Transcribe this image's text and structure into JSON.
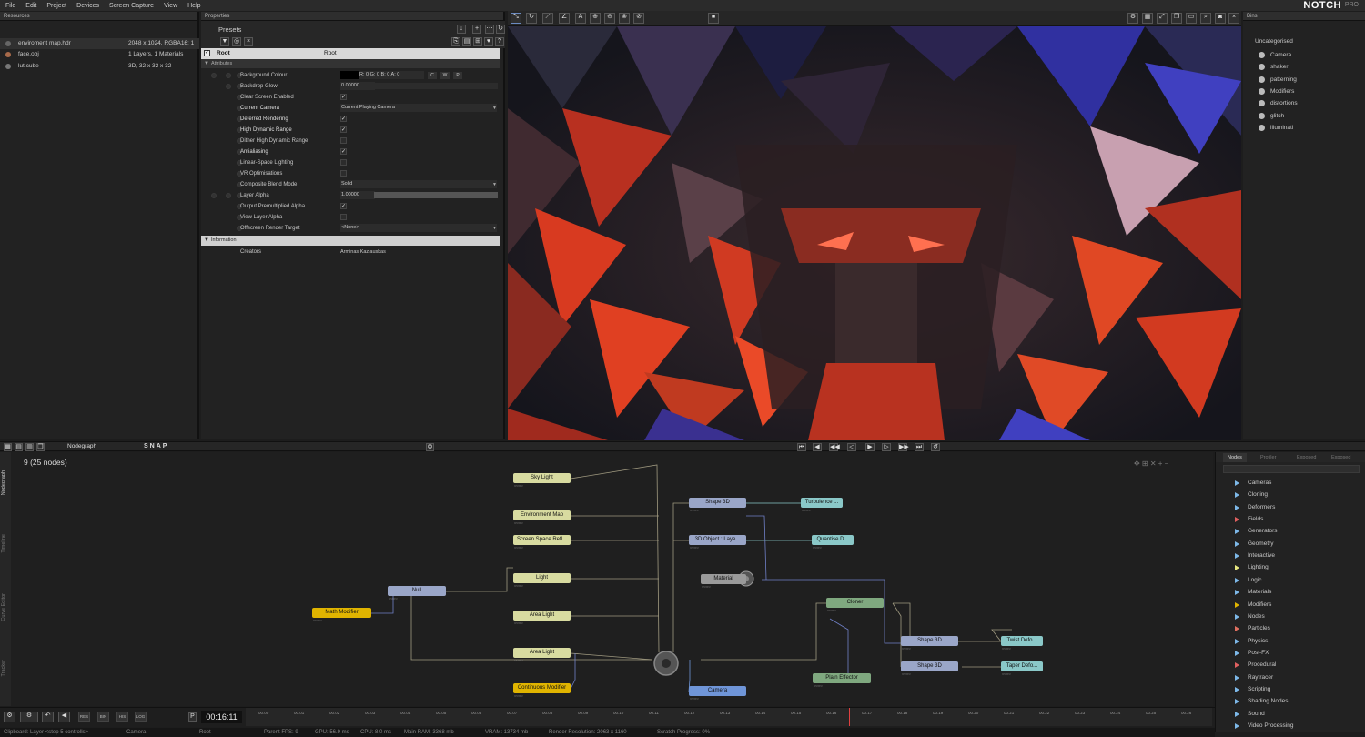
{
  "menu": [
    "File",
    "Edit",
    "Project",
    "Devices",
    "Screen Capture",
    "View",
    "Help"
  ],
  "brand": {
    "name": "NOTCH",
    "edition": "PRO"
  },
  "resources": {
    "title": "Resources",
    "items": [
      {
        "name": "enviroment map.hdr",
        "info": "2048 x 1024, RGBA16; 1"
      },
      {
        "name": "face.obj",
        "info": "1 Layers, 1 Materials"
      },
      {
        "name": "lut.cube",
        "info": "3D, 32 x 32 x 32"
      }
    ]
  },
  "properties": {
    "title": "Properties",
    "presets_label": "Presets",
    "root_label": "Root",
    "root_value": "Root",
    "attributes_label": "Attributes",
    "rows": [
      {
        "label": "Background Colour",
        "value": "R: 0 G: 0 B: 0 A: 0",
        "type": "color"
      },
      {
        "label": "Backdrop Glow",
        "value": "0.00000",
        "type": "slider"
      },
      {
        "label": "Clear Screen Enabled",
        "value": "✓",
        "type": "check"
      },
      {
        "label": "Current Camera",
        "value": "Current Playing Camera",
        "type": "dropdown"
      },
      {
        "label": "Deferred Rendering",
        "value": "✓",
        "type": "check"
      },
      {
        "label": "High Dynamic Range",
        "value": "✓",
        "type": "check"
      },
      {
        "label": "Dither High Dynamic Range",
        "value": "",
        "type": "check"
      },
      {
        "label": "Antialiasing",
        "value": "✓",
        "type": "check"
      },
      {
        "label": "Linear-Space Lighting",
        "value": "",
        "type": "check"
      },
      {
        "label": "VR Optimisations",
        "value": "",
        "type": "check"
      },
      {
        "label": "Composite Blend Mode",
        "value": "Solid",
        "type": "dropdown"
      },
      {
        "label": "Layer Alpha",
        "value": "1.00000",
        "type": "slider"
      },
      {
        "label": "Output Premultiplied Alpha",
        "value": "✓",
        "type": "check"
      },
      {
        "label": "View Layer Alpha",
        "value": "",
        "type": "check"
      },
      {
        "label": "Offscreen Render Target",
        "value": "<None>",
        "type": "dropdown"
      }
    ],
    "color_buttons": [
      "C",
      "W",
      "P"
    ],
    "information_label": "Information",
    "creators_label": "Creators",
    "creators_value": "Arminas Kazlauskas"
  },
  "bins": {
    "title": "Bins",
    "group": "Uncategorised",
    "items": [
      "Camera",
      "shaker",
      "patterning",
      "Modifiers",
      "distortions",
      "glitch",
      "illuminati"
    ]
  },
  "nodegraph": {
    "tab": "Nodegraph",
    "snap_label": "SNAP",
    "count_text": "9  (25  nodes)",
    "side_tabs": [
      "Nodegraph",
      "Timeline",
      "Curve Editor",
      "Tracker"
    ],
    "nodes": [
      {
        "id": "sky-light",
        "label": "Sky Light",
        "color": "#d8dba0"
      },
      {
        "id": "environment-map",
        "label": "Environment Map",
        "color": "#d8dba0"
      },
      {
        "id": "screen-space-refl",
        "label": "Screen Space Refl...",
        "color": "#d8dba0"
      },
      {
        "id": "light",
        "label": "Light",
        "color": "#d8dba0"
      },
      {
        "id": "area-light-1",
        "label": "Area Light",
        "color": "#d8dba0"
      },
      {
        "id": "area-light-2",
        "label": "Area Light",
        "color": "#d8dba0"
      },
      {
        "id": "continuous-modifier",
        "label": "Continuous Modifier",
        "color": "#e0b400"
      },
      {
        "id": "null",
        "label": "Null",
        "color": "#9aa6c8"
      },
      {
        "id": "math-modifier",
        "label": "Math Modifier",
        "color": "#e0b400"
      },
      {
        "id": "shape-3d-1",
        "label": "Shape 3D",
        "color": "#9aa6c8"
      },
      {
        "id": "turbulence",
        "label": "Turbulence ...",
        "color": "#8ac8c8"
      },
      {
        "id": "3d-object",
        "label": "3D Object : Laye...",
        "color": "#9aa6c8"
      },
      {
        "id": "quantise",
        "label": "Quantise D...",
        "color": "#8ac8c8"
      },
      {
        "id": "material",
        "label": "Material",
        "color": "#9a9a9a"
      },
      {
        "id": "cloner",
        "label": "Cloner",
        "color": "#7fa87f"
      },
      {
        "id": "shape-3d-2",
        "label": "Shape 3D",
        "color": "#9aa6c8"
      },
      {
        "id": "shape-3d-3",
        "label": "Shape 3D",
        "color": "#9aa6c8"
      },
      {
        "id": "twist-deform",
        "label": "Twist Defo...",
        "color": "#8ac8c8"
      },
      {
        "id": "taper-deform",
        "label": "Taper Defo...",
        "color": "#8ac8c8"
      },
      {
        "id": "plain-effector",
        "label": "Plain Effector",
        "color": "#7fa87f"
      },
      {
        "id": "camera",
        "label": "Camera",
        "color": "#6f95d8"
      }
    ]
  },
  "node_panel": {
    "tabs": [
      "Nodes",
      "Profiler",
      "Exposed",
      "Exposed"
    ],
    "categories": [
      {
        "label": "Cameras",
        "color": "#7db8e8"
      },
      {
        "label": "Cloning",
        "color": "#7db8e8"
      },
      {
        "label": "Deformers",
        "color": "#7db8e8"
      },
      {
        "label": "Fields",
        "color": "#e06060"
      },
      {
        "label": "Generators",
        "color": "#7db8e8"
      },
      {
        "label": "Geometry",
        "color": "#7db8e8"
      },
      {
        "label": "Interactive",
        "color": "#7db8e8"
      },
      {
        "label": "Lighting",
        "color": "#e8e880"
      },
      {
        "label": "Logic",
        "color": "#7db8e8"
      },
      {
        "label": "Materials",
        "color": "#7db8e8"
      },
      {
        "label": "Modifiers",
        "color": "#e0b400"
      },
      {
        "label": "Nodes",
        "color": "#7db8e8"
      },
      {
        "label": "Particles",
        "color": "#e07060"
      },
      {
        "label": "Physics",
        "color": "#7db8e8"
      },
      {
        "label": "Post-FX",
        "color": "#7db8e8"
      },
      {
        "label": "Procedural",
        "color": "#e06060"
      },
      {
        "label": "Raytracer",
        "color": "#7db8e8"
      },
      {
        "label": "Scripting",
        "color": "#7db8e8"
      },
      {
        "label": "Shading Nodes",
        "color": "#7db8e8"
      },
      {
        "label": "Sound",
        "color": "#7db8e8"
      },
      {
        "label": "Video Processing",
        "color": "#7db8e8"
      }
    ]
  },
  "timeline": {
    "time": "00:16:11",
    "buttons": [
      "RES",
      "BIN",
      "HIS",
      "LOG"
    ],
    "ticks": [
      "00:00",
      "00:01",
      "00:02",
      "00:03",
      "00:04",
      "00:05",
      "00:06",
      "00:07",
      "00:08",
      "00:09",
      "00:10",
      "00:11",
      "00:12",
      "00:13",
      "00:14",
      "00:15",
      "00:16",
      "00:17",
      "00:18",
      "00:19",
      "00:20",
      "00:21",
      "00:22",
      "00:23",
      "00:24",
      "00:25",
      "00:26"
    ]
  },
  "status": {
    "clipboard": "Clipboard: Layer <step 5 controlls>",
    "camera": "Camera",
    "root": "Root",
    "parent_fps": "Parent FPS: 9",
    "gpu": "GPU: 56.9 ms",
    "cpu": "CPU: 8.0 ms",
    "main_ram": "Main RAM: 3368 mb",
    "vram": "VRAM: 13734 mb",
    "render_res": "Render Resolution: 2063 x 1160",
    "scratch": "Scratch Progress: 0%"
  }
}
